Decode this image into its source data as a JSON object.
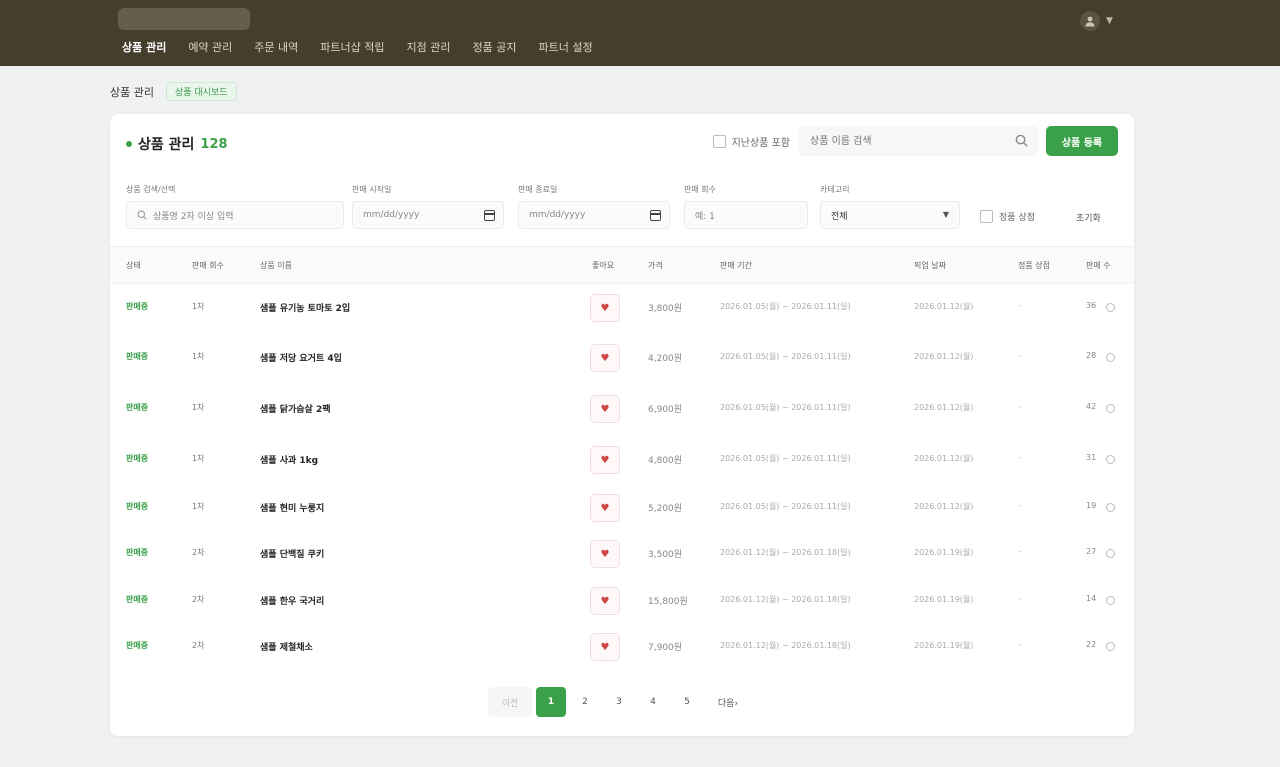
{
  "nav": {
    "items": [
      "상품 관리",
      "예약 관리",
      "주문 내역",
      "파트너샵 적립",
      "지점 관리",
      "정품 공지",
      "파트너 설정"
    ],
    "active_index": 0
  },
  "breadcrumb": {
    "title": "상품 관리",
    "badge": "상품 대시보드"
  },
  "card": {
    "title": "상품 관리",
    "count": "128",
    "soldout_checkbox_label": "지난상품 포함",
    "search_placeholder": "상품 이름 검색",
    "register_label": "상품 등록"
  },
  "filters": {
    "name": {
      "label": "상품 검색/선택",
      "placeholder": "상품명 2자 이상 입력"
    },
    "start": {
      "label": "판매 시작일",
      "value": "mm/dd/yyyy"
    },
    "end": {
      "label": "판매 종료일",
      "value": "mm/dd/yyyy"
    },
    "round": {
      "label": "판매 회수",
      "placeholder": "예: 1"
    },
    "category": {
      "label": "카테고리",
      "value": "전체"
    },
    "option_label": "정품 상점",
    "reset_label": "초기화"
  },
  "table": {
    "headers": [
      "상태",
      "판매 회수",
      "상품 이름",
      "좋아요",
      "가격",
      "판매 기간",
      "픽업 날짜",
      "정품 상점",
      "판매 수"
    ],
    "rows": [
      {
        "status": "판매중",
        "round": "1차",
        "name": "샘플 유기농 토마토 2입",
        "price": "3,800원",
        "period": "2026.01.05(월) ~ 2026.01.11(일)",
        "pickup": "2026.01.12(월)",
        "store": "-",
        "count": "36"
      },
      {
        "status": "판매중",
        "round": "1차",
        "name": "샘플 저당 요거트 4입",
        "price": "4,200원",
        "period": "2026.01.05(월) ~ 2026.01.11(일)",
        "pickup": "2026.01.12(월)",
        "store": "-",
        "count": "28"
      },
      {
        "status": "판매중",
        "round": "1차",
        "name": "샘플 닭가슴살 2팩",
        "price": "6,900원",
        "period": "2026.01.05(월) ~ 2026.01.11(일)",
        "pickup": "2026.01.12(월)",
        "store": "-",
        "count": "42"
      },
      {
        "status": "판매중",
        "round": "1차",
        "name": "샘플 사과 1kg",
        "price": "4,800원",
        "period": "2026.01.05(월) ~ 2026.01.11(일)",
        "pickup": "2026.01.12(월)",
        "store": "-",
        "count": "31"
      },
      {
        "status": "판매중",
        "round": "1차",
        "name": "샘플 현미 누룽지",
        "price": "5,200원",
        "period": "2026.01.05(월) ~ 2026.01.11(일)",
        "pickup": "2026.01.12(월)",
        "store": "-",
        "count": "19"
      },
      {
        "status": "판매중",
        "round": "2차",
        "name": "샘플 단백질 쿠키",
        "price": "3,500원",
        "period": "2026.01.12(월) ~ 2026.01.18(일)",
        "pickup": "2026.01.19(월)",
        "store": "-",
        "count": "27"
      },
      {
        "status": "판매중",
        "round": "2차",
        "name": "샘플 한우 국거리",
        "price": "15,800원",
        "period": "2026.01.12(월) ~ 2026.01.18(일)",
        "pickup": "2026.01.19(월)",
        "store": "-",
        "count": "14"
      },
      {
        "status": "판매중",
        "round": "2차",
        "name": "샘플 제철채소",
        "price": "7,900원",
        "period": "2026.01.12(월) ~ 2026.01.18(일)",
        "pickup": "2026.01.19(월)",
        "store": "-",
        "count": "22"
      }
    ]
  },
  "pagination": {
    "prev": "이전",
    "pages": [
      "1",
      "2",
      "3",
      "4",
      "5"
    ],
    "active": "1",
    "next": "다음›"
  },
  "colors": {
    "topbar": "#453e2c",
    "accent": "#3aa14a",
    "like": "#d04545"
  },
  "icons": {
    "search": "search-icon",
    "user": "user-icon",
    "calendar": "calendar-icon",
    "like": "heart-icon"
  }
}
